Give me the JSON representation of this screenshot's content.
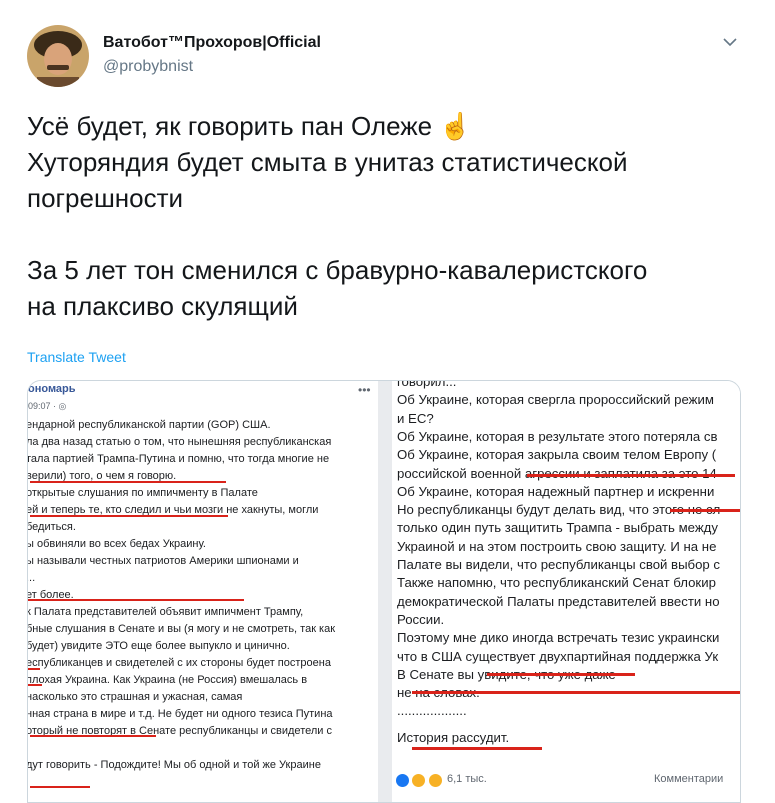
{
  "author": {
    "name": "Ватобот™Прохоров|Official",
    "handle": "@probybnist"
  },
  "tweet": {
    "lines": [
      "Усё будет, як говорить пан Олеже ☝",
      "Хуторяндия будет смыта в унитаз статистической",
      "погрешности",
      "",
      "За 5 лет тон сменился с бравурно-кавалеристского",
      "на плаксиво скулящий"
    ],
    "translate": "Translate Tweet"
  },
  "icons": {
    "menu": "chevron-down-icon",
    "pointing": "pointing-up-emoji"
  },
  "colors": {
    "link": "#1da1f2",
    "underline": "#d9231a",
    "fb_blue": "#385898"
  },
  "fb_left": {
    "name": "ономарь",
    "time": "09:07 · ",
    "lines": [
      "ендарной республиканской партии (GOP) США.",
      "ла два назад статью о том, что нынешняя республиканская",
      "тала партией Трампа-Путина и помню, что тогда многие не",
      "верили) того, о чем я говорю.",
      "открытые слушания по импичменту в Палате",
      "ей и теперь те, кто следил и чьи мозги не хакнуты, могли",
      "бедиться.",
      "ы обвиняли во всех бедах Украину.",
      "ы называли честных патриотов Америки шпионами и",
      "...",
      "ет более.",
      "к Палата представителей объявит импичмент Трампу,",
      "бные слушания в Сенате и вы (я могу и не смотреть, так как",
      "будет) увидите ЭТО еще более выпукло и цинично.",
      "еспубликанцев и свидетелей с их стороны будет построена",
      "плохая Украина. Как Украина (не Россия) вмешалась в",
      "насколько это страшная и ужасная, самая",
      "нная страна в мире и т.д. Не будет ни одного тезиса Путина",
      "оторый не повторят в Сенате республиканцы и свидетели с",
      "",
      "дут говорить - Подождите! Мы об одной и той же Украине"
    ]
  },
  "fb_right": {
    "lines": [
      "говорил...",
      "Об Украине, которая свергла пророссийский режим",
      "и ЕС?",
      "Об Украине, которая в результате этого потеряла св",
      "Об Украине, которая закрыла своим телом Европу (",
      "российской военной агрессии и заплатила за это 14",
      "Об Украине, которая надежный партнер и искренни",
      "Но республиканцы будут делать вид, что этого не сл",
      "только один путь защитить Трампа - выбрать между",
      "Украиной и на этом построить свою защиту. И на не",
      "Палате вы видели, что республиканцы свой выбор с",
      "Также напомню, что республиканский Сенат блокир",
      "демократической Палаты представителей ввести но",
      "России.",
      "Поэтому мне дико иногда встречать тезис украински",
      "что в США существует двухпартийная поддержка Ук",
      "В Сенате вы увидите, что уже даже -",
      "не на словах.",
      "...................",
      "История рассудит."
    ],
    "reactions_count": "6,1 тыс.",
    "comments": "Комментарии"
  }
}
